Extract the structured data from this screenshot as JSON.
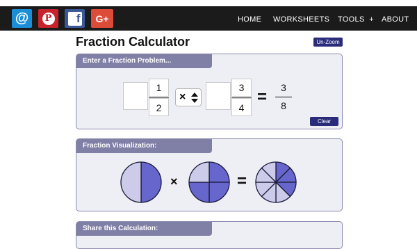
{
  "nav": {
    "social": {
      "email": "@",
      "pinterest": "P",
      "facebook": "f",
      "googleplus": "G+"
    },
    "links": [
      "HOME",
      "WORKSHEETS",
      "TOOLS  +",
      "ABOUT"
    ]
  },
  "page": {
    "title": "Fraction Calculator",
    "unzoom_label": "Un-Zoom"
  },
  "problem": {
    "header": "Enter a Fraction Problem...",
    "whole1": "",
    "num1": "1",
    "den1": "2",
    "operator": "×",
    "whole2": "",
    "num2": "3",
    "den2": "4",
    "equals": "=",
    "result_num": "3",
    "result_den": "8",
    "clear_label": "Clear"
  },
  "visualization": {
    "header": "Fraction Visualization:",
    "times": "×",
    "equals": "=",
    "pies": [
      {
        "name": "pie-one-half",
        "slices": 2,
        "filled": 1
      },
      {
        "name": "pie-three-quarters",
        "slices": 4,
        "filled": 3
      },
      {
        "name": "pie-three-eighths",
        "slices": 8,
        "filled": 3
      }
    ],
    "colors": {
      "filled": "#6666cc",
      "empty": "#ccccea",
      "stroke": "#1a1a3a"
    }
  },
  "share": {
    "header": "Share this Calculation:"
  },
  "colors": {
    "accent": "#2a2c7a",
    "tab": "#807fa6",
    "panel_bg": "#eeeef5",
    "border": "#8a89b0"
  }
}
